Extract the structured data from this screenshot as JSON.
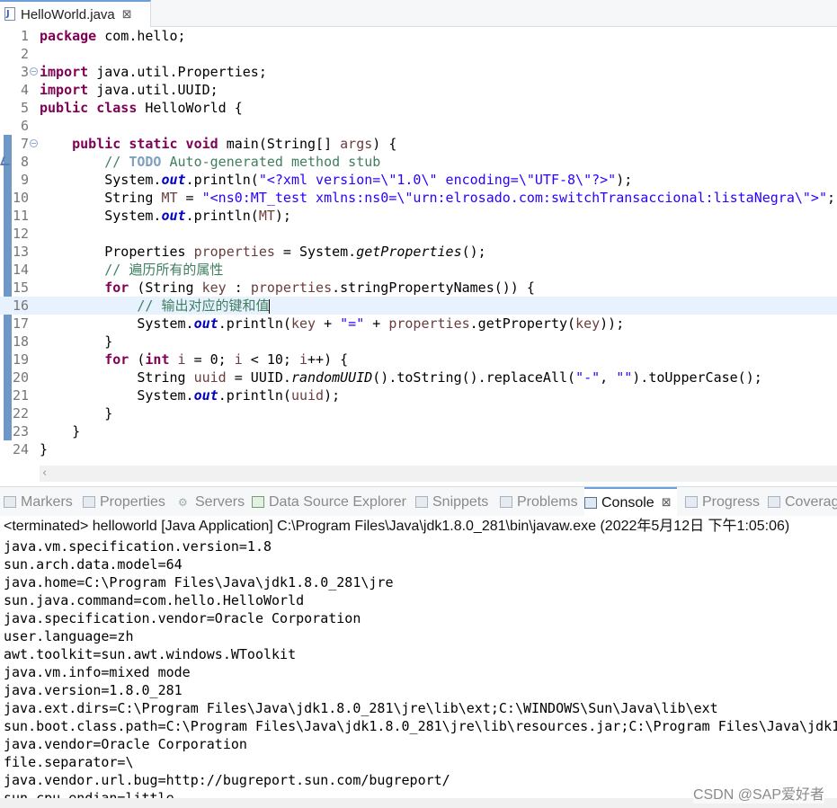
{
  "editor": {
    "tab": {
      "label": "HelloWorld.java",
      "close": "⊠"
    },
    "lines": [
      {
        "n": "1"
      },
      {
        "n": "2"
      },
      {
        "n": "3"
      },
      {
        "n": "4"
      },
      {
        "n": "5"
      },
      {
        "n": "6"
      },
      {
        "n": "7"
      },
      {
        "n": "8"
      },
      {
        "n": "9"
      },
      {
        "n": "10"
      },
      {
        "n": "11"
      },
      {
        "n": "12"
      },
      {
        "n": "13"
      },
      {
        "n": "14"
      },
      {
        "n": "15"
      },
      {
        "n": "16"
      },
      {
        "n": "17"
      },
      {
        "n": "18"
      },
      {
        "n": "19"
      },
      {
        "n": "20"
      },
      {
        "n": "21"
      },
      {
        "n": "22"
      },
      {
        "n": "23"
      },
      {
        "n": "24"
      }
    ],
    "code": {
      "l1_kw": "package",
      "l1_rest": " com.hello;",
      "l3_kw": "import",
      "l3_rest": " java.util.Properties;",
      "l4_kw": "import",
      "l4_rest": " java.util.UUID;",
      "l5_kw1": "public",
      "l5_kw2": "class",
      "l5_rest": " HelloWorld {",
      "l7_kw": "public static void",
      "l7_rest": " main(String[] ",
      "l7_var": "args",
      "l7_end": ") {",
      "l8_cm1": "// ",
      "l8_todo": "TODO",
      "l8_cm2": " Auto-generated method stub",
      "l9_a": "System.",
      "l9_fld": "out",
      "l9_b": ".println(",
      "l9_str": "\"<?xml version=\\\"1.0\\\" encoding=\\\"UTF-8\\\"?>\"",
      "l9_c": ");",
      "l10_a": "String ",
      "l10_var": "MT",
      "l10_b": " = ",
      "l10_str": "\"<ns0:MT_test xmlns:ns0=\\\"urn:elrosado.com:switchTransaccional:listaNegra\\\">\"",
      "l10_c": ";",
      "l11_a": "System.",
      "l11_fld": "out",
      "l11_b": ".println(",
      "l11_var": "MT",
      "l11_c": ");",
      "l13_a": "Properties ",
      "l13_var": "properties",
      "l13_b": " = System.",
      "l13_st": "getProperties",
      "l13_c": "();",
      "l14_cm": "// 遍历所有的属性",
      "l15_kw": "for",
      "l15_a": " (String ",
      "l15_var1": "key",
      "l15_b": " : ",
      "l15_var2": "properties",
      "l15_c": ".stringPropertyNames()) {",
      "l16_cm": "// 输出对应的键和值",
      "l17_a": "System.",
      "l17_fld": "out",
      "l17_b": ".println(",
      "l17_var1": "key",
      "l17_c": " + ",
      "l17_str": "\"=\"",
      "l17_d": " + ",
      "l17_var2": "properties",
      "l17_e": ".getProperty(",
      "l17_var3": "key",
      "l17_f": "));",
      "l18": "}",
      "l19_kw1": "for",
      "l19_a": " (",
      "l19_kw2": "int",
      "l19_b": " ",
      "l19_var1": "i",
      "l19_c": " = 0; ",
      "l19_var2": "i",
      "l19_d": " < 10; ",
      "l19_var3": "i",
      "l19_e": "++) {",
      "l20_a": "String ",
      "l20_var": "uuid",
      "l20_b": " = UUID.",
      "l20_st": "randomUUID",
      "l20_c": "().toString().replaceAll(",
      "l20_str1": "\"-\"",
      "l20_d": ", ",
      "l20_str2": "\"\"",
      "l20_e": ").toUpperCase();",
      "l21_a": "System.",
      "l21_fld": "out",
      "l21_b": ".println(",
      "l21_var": "uuid",
      "l21_c": ");",
      "l22": "}",
      "l23": "}",
      "l24": "}"
    }
  },
  "panel": {
    "tabs": [
      "Markers",
      "Properties",
      "Servers",
      "Data Source Explorer",
      "Snippets",
      "Problems",
      "Console",
      "Progress",
      "Coverag"
    ],
    "console_close": "⊠",
    "console_header": "<terminated> helloworld [Java Application] C:\\Program Files\\Java\\jdk1.8.0_281\\bin\\javaw.exe (2022年5月12日 下午1:05:06)",
    "output": [
      "java.vm.specification.version=1.8",
      "sun.arch.data.model=64",
      "java.home=C:\\Program Files\\Java\\jdk1.8.0_281\\jre",
      "sun.java.command=com.hello.HelloWorld",
      "java.specification.vendor=Oracle Corporation",
      "user.language=zh",
      "awt.toolkit=sun.awt.windows.WToolkit",
      "java.vm.info=mixed mode",
      "java.version=1.8.0_281",
      "java.ext.dirs=C:\\Program Files\\Java\\jdk1.8.0_281\\jre\\lib\\ext;C:\\WINDOWS\\Sun\\Java\\lib\\ext",
      "sun.boot.class.path=C:\\Program Files\\Java\\jdk1.8.0_281\\jre\\lib\\resources.jar;C:\\Program Files\\Java\\jdk1",
      "java.vendor=Oracle Corporation",
      "file.separator=\\",
      "java.vendor.url.bug=http://bugreport.sun.com/bugreport/",
      "sun.cpu.endian=little"
    ]
  },
  "watermark": "CSDN @SAP爱好者"
}
